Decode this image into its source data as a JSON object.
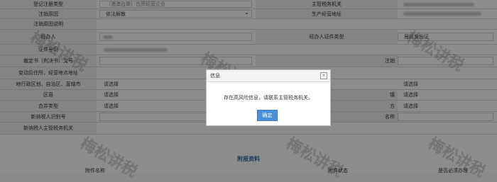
{
  "form": {
    "registration_type": {
      "label": "登记注册类型",
      "value": "（港澳台商）合资经营企业"
    },
    "tax_authority": {
      "label": "主管税务机关"
    },
    "cancel_reason": {
      "label": "注销原因",
      "value": "依法解散"
    },
    "production_address": {
      "label": "生产经营地址"
    },
    "cancel_reason_desc": {
      "label": "注销原因说明"
    },
    "agent": {
      "label": "经办人"
    },
    "agent_id_type": {
      "label": "经办人证件类型",
      "value": "居民身份证"
    },
    "id_number": {
      "label": "证件号码"
    },
    "ruling_doc": {
      "label": "裁定书（判决书）文号"
    },
    "cancel_date": {
      "label": "注销"
    },
    "changed_residence": {
      "label": "变动后住所、经营地点地址"
    },
    "admin_division": {
      "label": "地行政区划、自治区、直辖市",
      "value": "请选择"
    },
    "admin_right": {
      "value": "请选择"
    },
    "district": {
      "label": "区县",
      "value": "请选择",
      "right_label": "镇",
      "right_value": "请选择"
    },
    "merge_party": {
      "label": "合并类型",
      "value": "请选择",
      "right_label": "方",
      "right_value": "请选择"
    },
    "new_taxpayer_id": {
      "label": "新纳税人识别号",
      "right_label": "名称"
    },
    "new_taxpayer_authority": {
      "label": "新纳税人主管税务机关"
    }
  },
  "section": {
    "title": "附报资料"
  },
  "table_headers": {
    "name": "附件名称",
    "status": "附件状态",
    "required": "是否必须办理"
  },
  "watermark": "梅松讲税",
  "dialog": {
    "title": "信息",
    "close": "×",
    "message": "存在高风险信息，请联系主管税务机关。",
    "ok": "确定"
  },
  "select_arrow": "⌄"
}
